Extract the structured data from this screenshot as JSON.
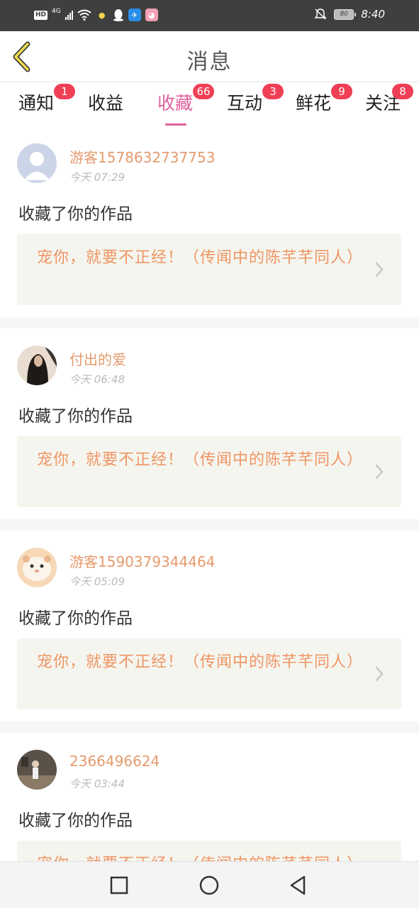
{
  "status_bar": {
    "hd": "HD",
    "network": "4G",
    "battery": "80",
    "time": "8:40",
    "icons": [
      "signal-icon",
      "wifi-icon",
      "app-icon",
      "qq-icon",
      "app-icon",
      "app-icon",
      "mute-bell-icon",
      "battery-icon"
    ]
  },
  "header": {
    "title": "消息",
    "back_icon": "chevron-left-icon"
  },
  "tabs": [
    {
      "label": "通知",
      "badge": "1"
    },
    {
      "label": "收益",
      "badge": ""
    },
    {
      "label": "收藏",
      "badge": "66",
      "active": true
    },
    {
      "label": "互动",
      "badge": "3"
    },
    {
      "label": "鲜花",
      "badge": "9"
    },
    {
      "label": "关注",
      "badge": "8"
    }
  ],
  "feed": [
    {
      "user": "游客1578632737753",
      "time": "今天 07:29",
      "action": "收藏了你的作品",
      "work": "宠你，就要不正经！（传闻中的陈芊芊同人）"
    },
    {
      "user": "付出的爱",
      "time": "今天 06:48",
      "action": "收藏了你的作品",
      "work": "宠你，就要不正经！（传闻中的陈芊芊同人）"
    },
    {
      "user": "游客1590379344464",
      "time": "今天 05:09",
      "action": "收藏了你的作品",
      "work": "宠你，就要不正经！（传闻中的陈芊芊同人）"
    },
    {
      "user": "2366496624",
      "time": "今天 03:44",
      "action": "收藏了你的作品",
      "work": "宠你，就要不正经！（传闻中的陈芊芊同人）"
    }
  ],
  "nav": {
    "icons": [
      "recent-apps-icon",
      "home-icon",
      "back-triangle-icon"
    ]
  },
  "colors": {
    "accent": "#e0609e",
    "badge": "#ef3f55",
    "username": "#e59a6d",
    "work_title": "#ef9563",
    "card_bg": "#f5f5ef"
  }
}
